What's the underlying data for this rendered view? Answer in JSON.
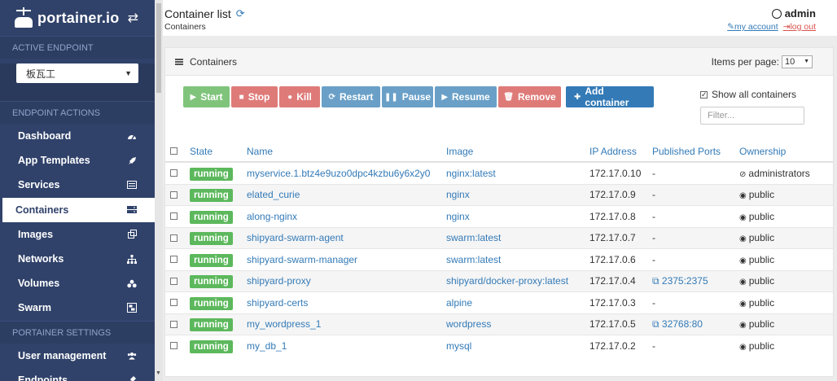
{
  "brand": {
    "name": "portainer.io"
  },
  "sidebar": {
    "active_endpoint_label": "ACTIVE ENDPOINT",
    "endpoint_value": "板瓦工",
    "endpoint_actions_label": "ENDPOINT ACTIONS",
    "items": [
      {
        "label": "Dashboard",
        "icon": "tachometer-icon"
      },
      {
        "label": "App Templates",
        "icon": "rocket-icon"
      },
      {
        "label": "Services",
        "icon": "list-alt-icon"
      },
      {
        "label": "Containers",
        "icon": "server-icon"
      },
      {
        "label": "Images",
        "icon": "clone-icon"
      },
      {
        "label": "Networks",
        "icon": "sitemap-icon"
      },
      {
        "label": "Volumes",
        "icon": "cubes-icon"
      },
      {
        "label": "Swarm",
        "icon": "object-group-icon"
      }
    ],
    "settings_label": "PORTAINER SETTINGS",
    "settings_items": [
      {
        "label": "User management",
        "icon": "users-icon"
      },
      {
        "label": "Endpoints",
        "icon": "plug-icon"
      }
    ]
  },
  "header": {
    "title": "Container list",
    "breadcrumb": "Containers",
    "user": "admin",
    "my_account": "my account",
    "log_out": "log out"
  },
  "panel": {
    "title": "Containers",
    "items_per_page_label": "Items per page:",
    "items_per_page_value": "10",
    "show_all_label": "Show all containers",
    "filter_placeholder": "Filter..."
  },
  "toolbar": {
    "start": "Start",
    "stop": "Stop",
    "kill": "Kill",
    "restart": "Restart",
    "pause": "Pause",
    "resume": "Resume",
    "remove": "Remove",
    "add": "Add container"
  },
  "table": {
    "columns": [
      "State",
      "Name",
      "Image",
      "IP Address",
      "Published Ports",
      "Ownership"
    ],
    "rows": [
      {
        "state": "running",
        "name": "myservice.1.btz4e9uzo0dpc4kzbu6y6x2y0",
        "image": "nginx:latest",
        "ip": "172.17.0.10",
        "ports": "-",
        "ownership": "administrators"
      },
      {
        "state": "running",
        "name": "elated_curie",
        "image": "nginx",
        "ip": "172.17.0.9",
        "ports": "-",
        "ownership": "public"
      },
      {
        "state": "running",
        "name": "along-nginx",
        "image": "nginx",
        "ip": "172.17.0.8",
        "ports": "-",
        "ownership": "public"
      },
      {
        "state": "running",
        "name": "shipyard-swarm-agent",
        "image": "swarm:latest",
        "ip": "172.17.0.7",
        "ports": "-",
        "ownership": "public"
      },
      {
        "state": "running",
        "name": "shipyard-swarm-manager",
        "image": "swarm:latest",
        "ip": "172.17.0.6",
        "ports": "-",
        "ownership": "public"
      },
      {
        "state": "running",
        "name": "shipyard-proxy",
        "image": "shipyard/docker-proxy:latest",
        "ip": "172.17.0.4",
        "ports": "2375:2375",
        "ownership": "public"
      },
      {
        "state": "running",
        "name": "shipyard-certs",
        "image": "alpine",
        "ip": "172.17.0.3",
        "ports": "-",
        "ownership": "public"
      },
      {
        "state": "running",
        "name": "my_wordpress_1",
        "image": "wordpress",
        "ip": "172.17.0.5",
        "ports": "32768:80",
        "ownership": "public"
      },
      {
        "state": "running",
        "name": "my_db_1",
        "image": "mysql",
        "ip": "172.17.0.2",
        "ports": "-",
        "ownership": "public"
      }
    ]
  }
}
